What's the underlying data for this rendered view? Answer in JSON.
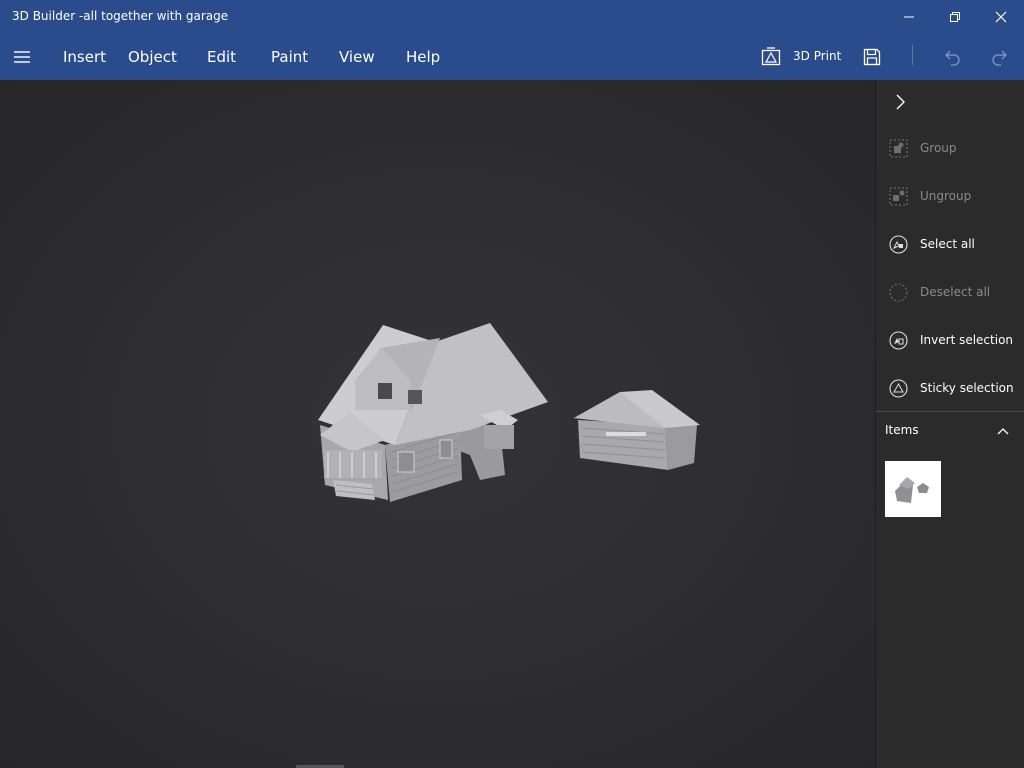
{
  "window": {
    "title": "3D Builder -all together with garage",
    "controls": [
      "minimize-icon",
      "restore-icon",
      "close-icon"
    ]
  },
  "menubar": {
    "menu_icon": "hamburger-icon",
    "items": [
      {
        "label": "Insert"
      },
      {
        "label": "Object"
      },
      {
        "label": "Edit"
      },
      {
        "label": "Paint"
      },
      {
        "label": "View"
      },
      {
        "label": "Help"
      }
    ],
    "print_label": "3D Print",
    "print_icon": "3d-print-icon",
    "save_icon": "save-icon",
    "undo_icon": "undo-icon",
    "redo_icon": "redo-icon"
  },
  "scene": {
    "objects": [
      "house",
      "garage"
    ]
  },
  "sidepanel": {
    "collapse_icon": "chevron-right-icon",
    "actions": [
      {
        "label": "Group",
        "icon": "group-icon",
        "enabled": false
      },
      {
        "label": "Ungroup",
        "icon": "ungroup-icon",
        "enabled": false
      },
      {
        "label": "Select all",
        "icon": "select-all-icon",
        "enabled": true
      },
      {
        "label": "Deselect all",
        "icon": "deselect-all-icon",
        "enabled": false
      },
      {
        "label": "Invert selection",
        "icon": "invert-selection-icon",
        "enabled": true
      },
      {
        "label": "Sticky selection",
        "icon": "sticky-selection-icon",
        "enabled": true
      }
    ],
    "items_header": "Items",
    "items_toggle_icon": "chevron-up-icon"
  },
  "colors": {
    "titlebar": "#2b4c8c",
    "background": "#2b2b2b",
    "model": "#b8b8bc"
  }
}
